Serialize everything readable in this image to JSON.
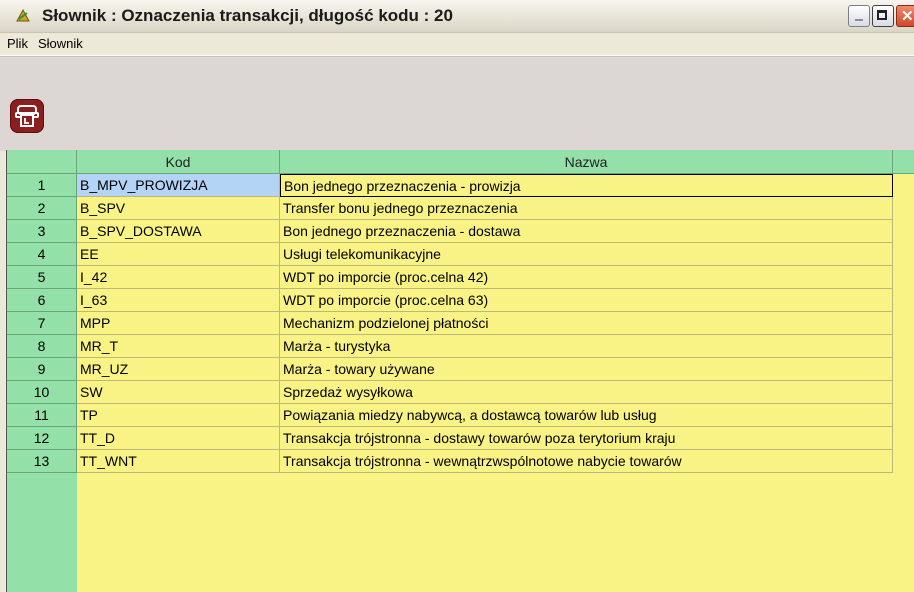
{
  "window": {
    "title": "Słownik : Oznaczenia transakcji,  długość kodu : 20"
  },
  "menu": {
    "items": [
      "Plik",
      "Słownik"
    ]
  },
  "toolbar": {
    "print_icon": "printer-icon"
  },
  "colors": {
    "header_bg": "#93e0a8",
    "row_bg": "#f8f384",
    "selection": "#b3d4f5",
    "toolbar_bg": "#dcd6d4",
    "print_button": "#8b1e1e"
  },
  "table": {
    "columns": [
      "Kod",
      "Nazwa"
    ],
    "rows": [
      {
        "num": "1",
        "kod": "B_MPV_PROWIZJA",
        "nazwa": "Bon jednego przeznaczenia - prowizja"
      },
      {
        "num": "2",
        "kod": "B_SPV",
        "nazwa": "Transfer bonu jednego przeznaczenia"
      },
      {
        "num": "3",
        "kod": "B_SPV_DOSTAWA",
        "nazwa": "Bon jednego przeznaczenia - dostawa"
      },
      {
        "num": "4",
        "kod": "EE",
        "nazwa": "Usługi telekomunikacyjne"
      },
      {
        "num": "5",
        "kod": "I_42",
        "nazwa": "WDT po imporcie (proc.celna 42)"
      },
      {
        "num": "6",
        "kod": "I_63",
        "nazwa": "WDT po imporcie (proc.celna 63)"
      },
      {
        "num": "7",
        "kod": "MPP",
        "nazwa": "Mechanizm podzielonej płatności"
      },
      {
        "num": "8",
        "kod": "MR_T",
        "nazwa": "Marża - turystyka"
      },
      {
        "num": "9",
        "kod": "MR_UZ",
        "nazwa": "Marża - towary używane"
      },
      {
        "num": "10",
        "kod": "SW",
        "nazwa": "Sprzedaż wysyłkowa"
      },
      {
        "num": "11",
        "kod": "TP",
        "nazwa": "Powiązania miedzy nabywcą, a dostawcą towarów lub usług"
      },
      {
        "num": "12",
        "kod": "TT_D",
        "nazwa": "Transakcja trójstronna - dostawy towarów poza terytorium kraju"
      },
      {
        "num": "13",
        "kod": "TT_WNT",
        "nazwa": "Transakcja trójstronna - wewnątrzwspólnotowe nabycie towarów"
      }
    ]
  }
}
